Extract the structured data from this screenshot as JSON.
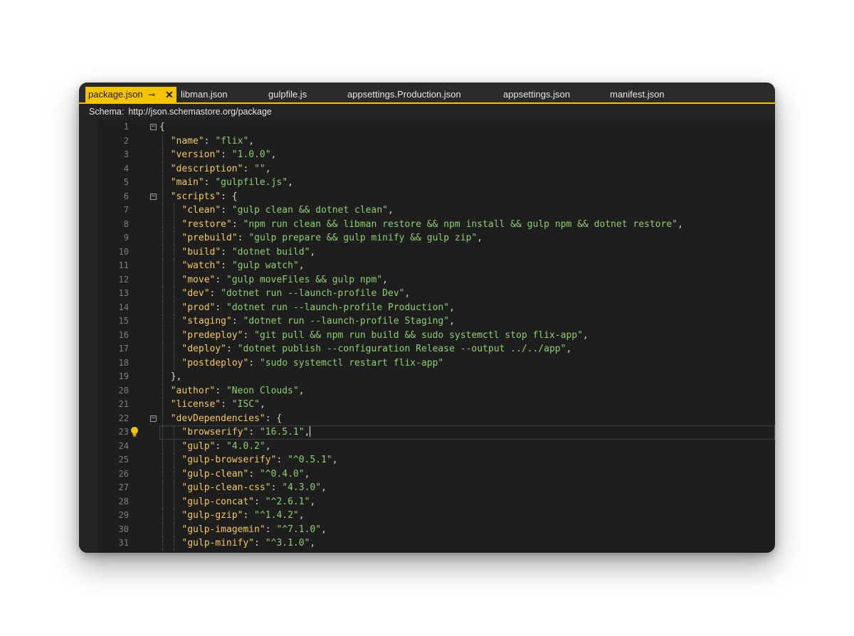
{
  "tabs": [
    {
      "label": "package.json",
      "active": true
    },
    {
      "label": "libman.json"
    },
    {
      "label": "gulpfile.js"
    },
    {
      "label": "appsettings.Production.json"
    },
    {
      "label": "appsettings.json"
    },
    {
      "label": "manifest.json"
    }
  ],
  "tab_pin_glyph": "⊸",
  "tab_close_glyph": "✕",
  "schema": {
    "label": "Schema:",
    "url": "http://json.schemastore.org/package"
  },
  "colors": {
    "accent": "#f5c400",
    "key": "#f5c95a",
    "string": "#8dcf6d",
    "background": "#1e1e1f"
  },
  "editor": {
    "current_line": 23,
    "lines": [
      {
        "n": "1",
        "text": "{"
      },
      {
        "n": "2",
        "text": "\"name\": \"flix\","
      },
      {
        "n": "3",
        "text": "\"version\": \"1.0.0\","
      },
      {
        "n": "4",
        "text": "\"description\": \"\","
      },
      {
        "n": "5",
        "text": "\"main\": \"gulpfile.js\","
      },
      {
        "n": "6",
        "text": "\"scripts\": {"
      },
      {
        "n": "7",
        "text": "\"clean\": \"gulp clean && dotnet clean\","
      },
      {
        "n": "8",
        "text": "\"restore\": \"npm run clean && libman restore && npm install && gulp npm && dotnet restore\","
      },
      {
        "n": "9",
        "text": "\"prebuild\": \"gulp prepare && gulp minify && gulp zip\","
      },
      {
        "n": "10",
        "text": "\"build\": \"dotnet build\","
      },
      {
        "n": "11",
        "text": "\"watch\": \"gulp watch\","
      },
      {
        "n": "12",
        "text": "\"move\": \"gulp moveFiles && gulp npm\","
      },
      {
        "n": "13",
        "text": "\"dev\": \"dotnet run --launch-profile Dev\","
      },
      {
        "n": "14",
        "text": "\"prod\": \"dotnet run --launch-profile Production\","
      },
      {
        "n": "15",
        "text": "\"staging\": \"dotnet run --launch-profile Staging\","
      },
      {
        "n": "16",
        "text": "\"predeploy\": \"git pull && npm run build && sudo systemctl stop flix-app\","
      },
      {
        "n": "17",
        "text": "\"deploy\": \"dotnet publish --configuration Release --output ../../app\","
      },
      {
        "n": "18",
        "text": "\"postdeploy\": \"sudo systemctl restart flix-app\""
      },
      {
        "n": "19",
        "text": "},"
      },
      {
        "n": "20",
        "text": "\"author\": \"Neon Clouds\","
      },
      {
        "n": "21",
        "text": "\"license\": \"ISC\","
      },
      {
        "n": "22",
        "text": "\"devDependencies\": {"
      },
      {
        "n": "23",
        "text": "\"browserify\": \"16.5.1\","
      },
      {
        "n": "24",
        "text": "\"gulp\": \"4.0.2\","
      },
      {
        "n": "25",
        "text": "\"gulp-browserify\": \"^0.5.1\","
      },
      {
        "n": "26",
        "text": "\"gulp-clean\": \"^0.4.0\","
      },
      {
        "n": "27",
        "text": "\"gulp-clean-css\": \"4.3.0\","
      },
      {
        "n": "28",
        "text": "\"gulp-concat\": \"^2.6.1\","
      },
      {
        "n": "29",
        "text": "\"gulp-gzip\": \"^1.4.2\","
      },
      {
        "n": "30",
        "text": "\"gulp-imagemin\": \"^7.1.0\","
      },
      {
        "n": "31",
        "text": "\"gulp-minify\": \"^3.1.0\","
      }
    ]
  }
}
